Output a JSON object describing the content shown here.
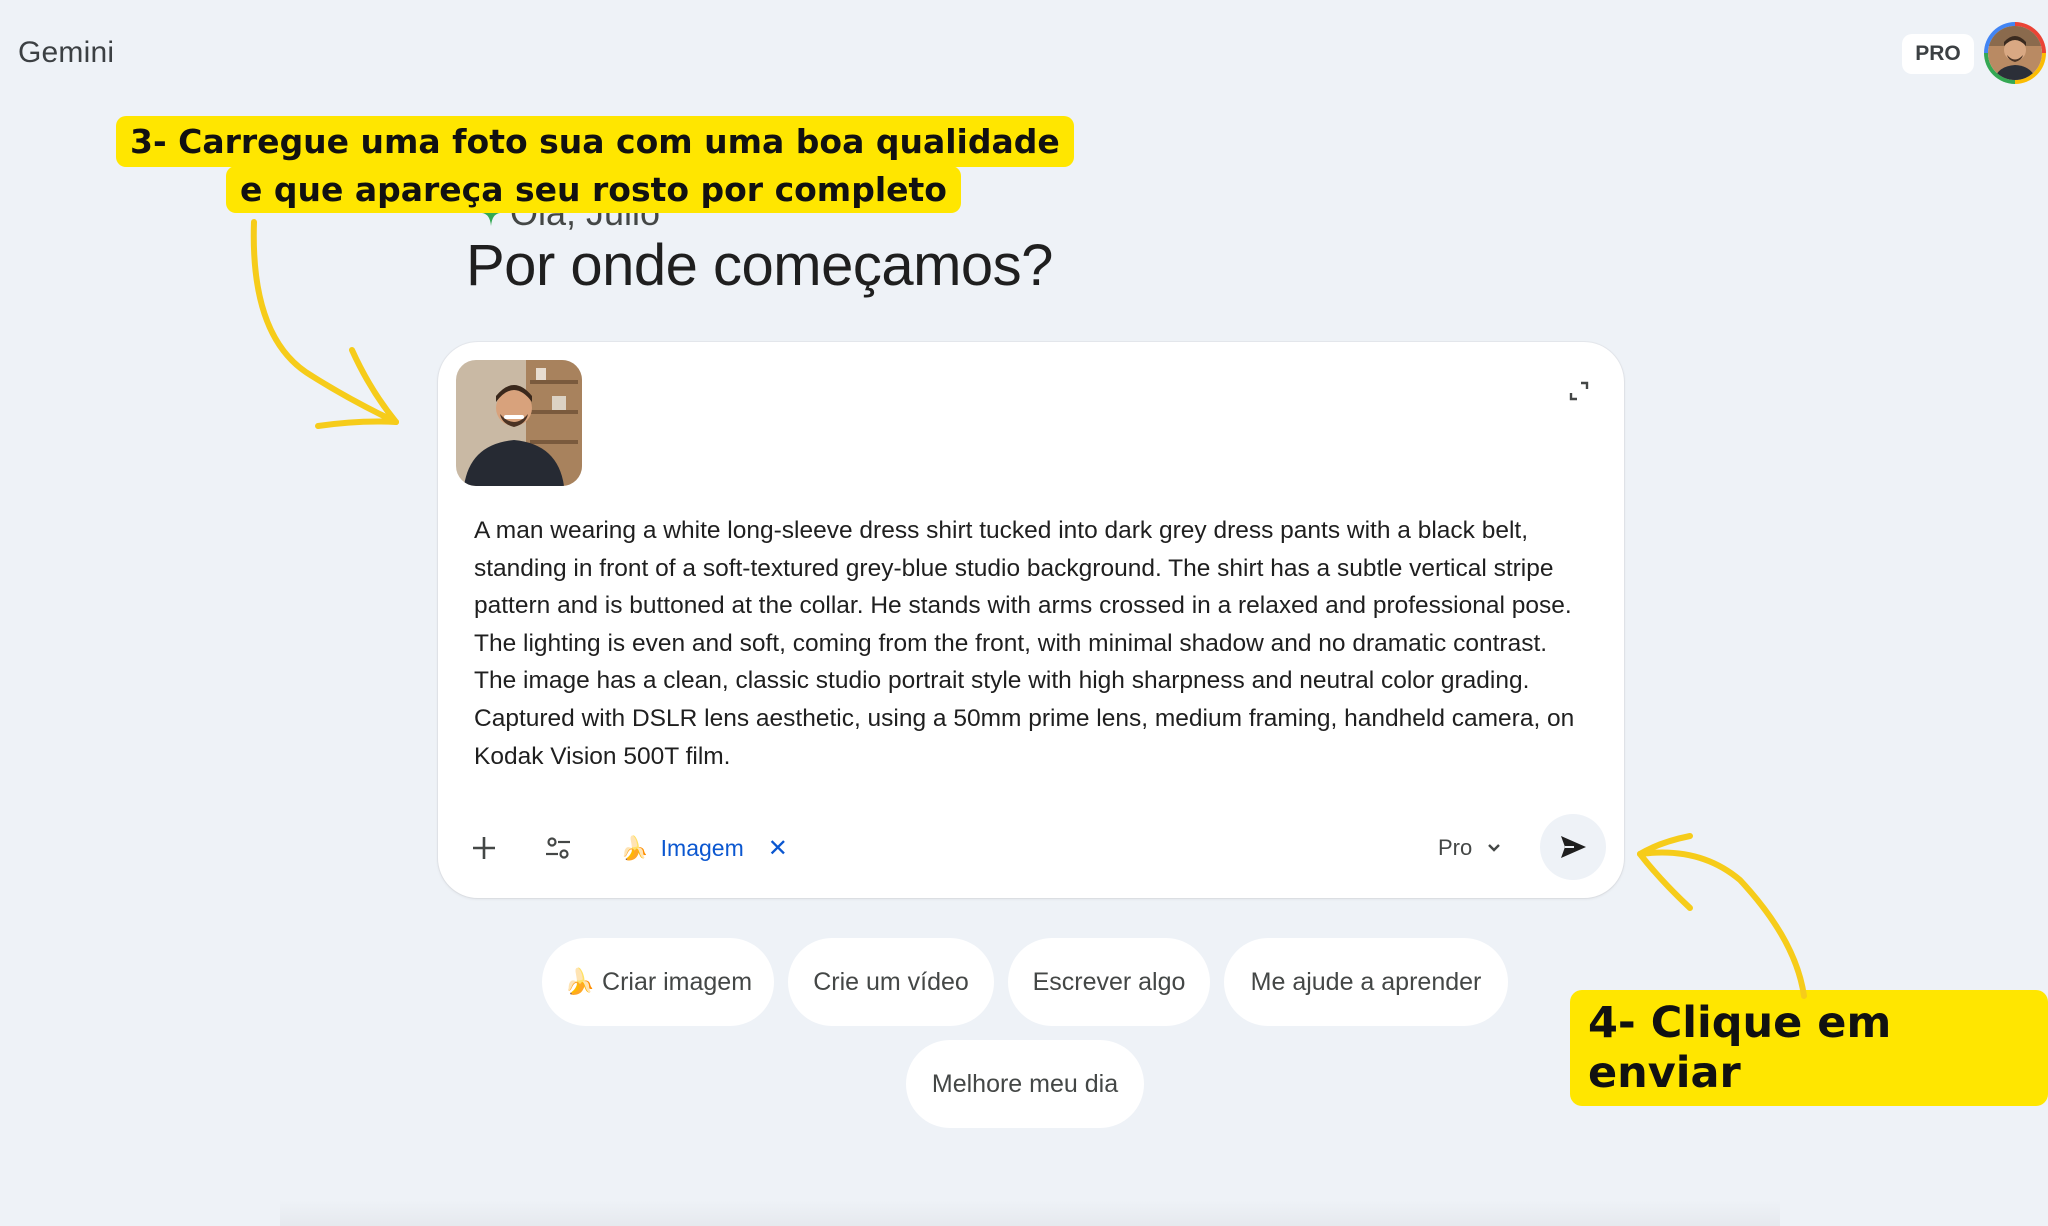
{
  "app": {
    "title": "Gemini",
    "plan_badge": "PRO"
  },
  "greeting": {
    "text": "Olá, Julio",
    "headline": "Por onde começamos?"
  },
  "composer": {
    "attachment_alt": "foto enviada",
    "prompt": "A man wearing a white long-sleeve dress shirt tucked into dark grey dress pants with a black belt, standing in front of a soft-textured grey-blue studio background. The shirt has a subtle vertical stripe pattern and is buttoned at the collar. He stands with arms crossed in a relaxed and professional pose. The lighting is even and soft, coming from the front, with minimal shadow and no dramatic contrast. The image has a clean, classic studio portrait style with high sharpness and neutral color grading. Captured with DSLR lens aesthetic, using a 50mm prime lens, medium framing, handheld camera, on Kodak Vision 500T film.",
    "tool_chip": {
      "emoji": "🍌",
      "label": "Imagem",
      "close": "✕"
    },
    "model": "Pro",
    "icons": {
      "add": "plus-icon",
      "tools": "tune-icon",
      "expand": "expand-icon",
      "model_chevron": "chevron-down-icon",
      "send": "send-icon"
    }
  },
  "suggestions": [
    {
      "label": "🍌 Criar imagem"
    },
    {
      "label": "Crie um vídeo"
    },
    {
      "label": "Escrever algo"
    },
    {
      "label": "Me ajude a aprender"
    },
    {
      "label": "Melhore meu dia"
    }
  ],
  "annotations": {
    "step3_line1": "3- Carregue uma foto sua com uma boa qualidade",
    "step3_line2": "e que apareça seu rosto por completo",
    "step4": "4- Clique em enviar"
  },
  "colors": {
    "background": "#eef2f7",
    "annotation_yellow": "#ffe600",
    "link_blue": "#0b57d0",
    "text": "#1f1f1f"
  }
}
